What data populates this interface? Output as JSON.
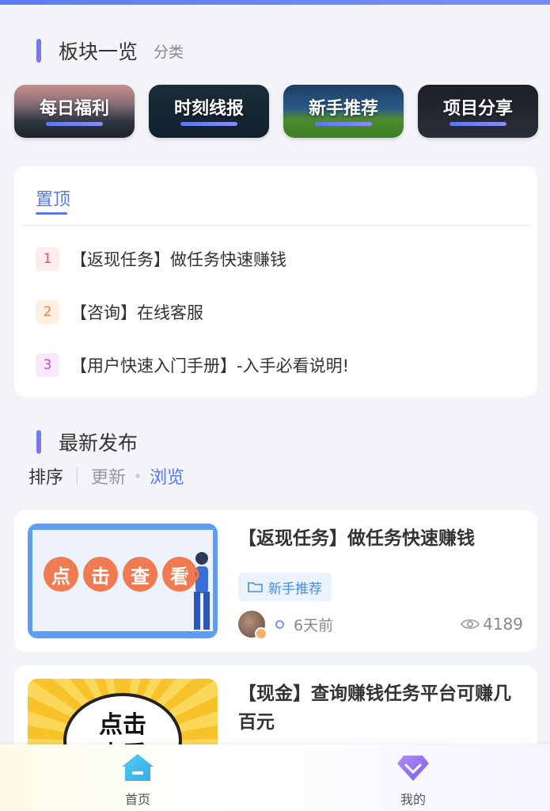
{
  "boards_section": {
    "title": "板块一览",
    "subtitle": "分类"
  },
  "boards": [
    {
      "label": "每日福利"
    },
    {
      "label": "时刻线报"
    },
    {
      "label": "新手推荐"
    },
    {
      "label": "项目分享"
    }
  ],
  "pinned": {
    "tab_label": "置顶",
    "items": [
      {
        "num": "1",
        "text": "【返现任务】做任务快速赚钱",
        "color": "#e0576a",
        "bg": "#fdecee"
      },
      {
        "num": "2",
        "text": "【咨询】在线客服",
        "color": "#e8892e",
        "bg": "#fdf0e2"
      },
      {
        "num": "3",
        "text": "【用户快速入门手册】-入手必看说明!",
        "color": "#c04fd6",
        "bg": "#f7e9fb"
      }
    ]
  },
  "latest_section": {
    "title": "最新发布"
  },
  "sort": {
    "label": "排序",
    "options": [
      "更新",
      "浏览"
    ],
    "active": "浏览"
  },
  "posts": [
    {
      "title": "【返现任务】做任务快速赚钱",
      "thumb_text": [
        "点",
        "击",
        "查",
        "看"
      ],
      "tag": "新手推荐",
      "time": "6天前",
      "views": "4189"
    },
    {
      "title": "【现金】查询赚钱任务平台可赚几百元",
      "thumb_text": [
        "点击",
        "查看"
      ]
    }
  ],
  "tabbar": {
    "home_label": "首页",
    "mine_label": "我的"
  }
}
